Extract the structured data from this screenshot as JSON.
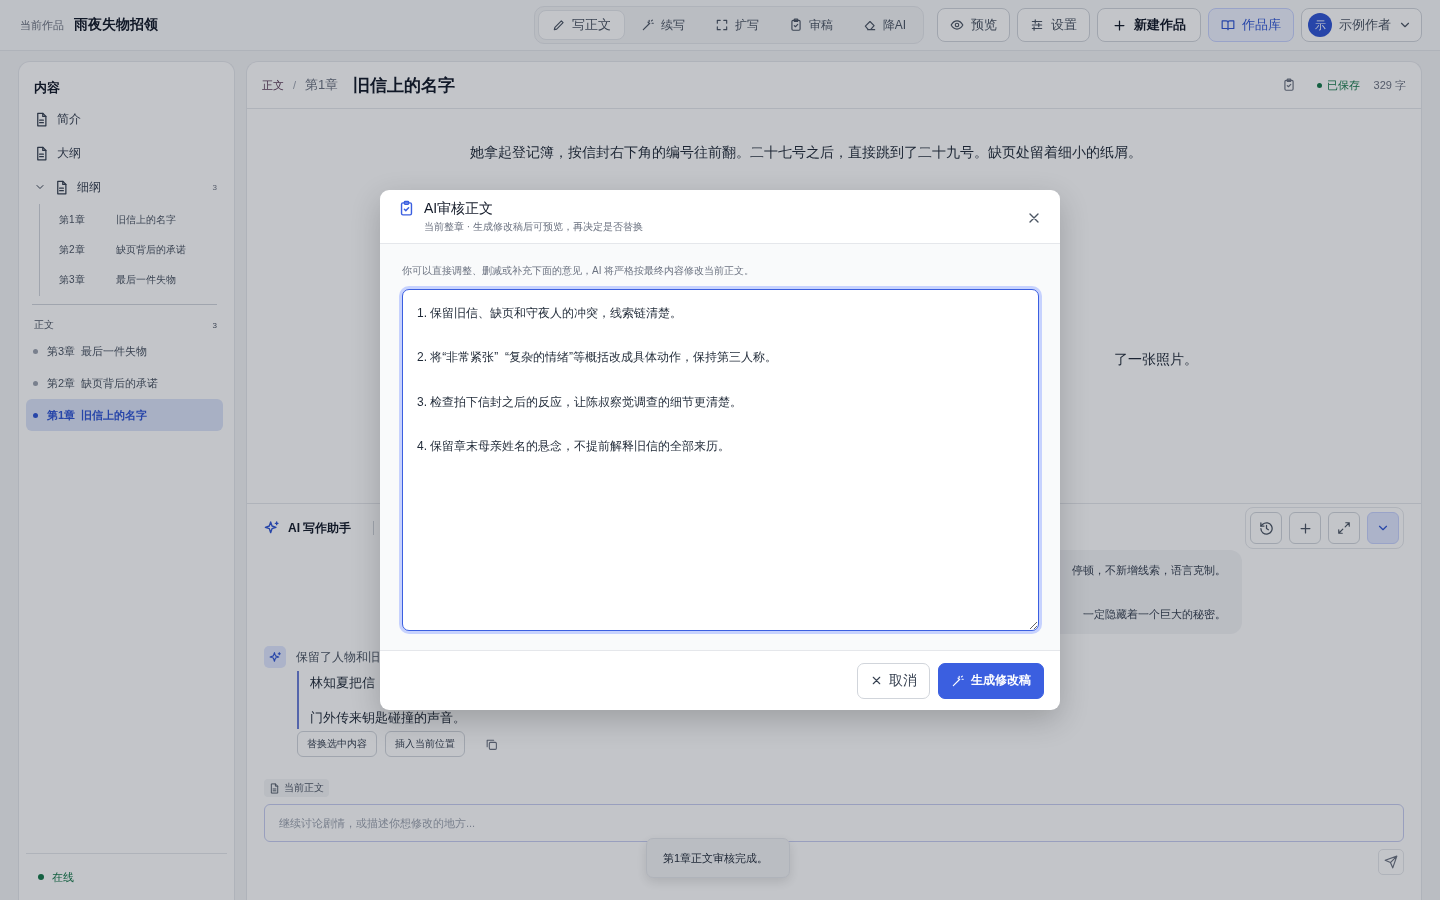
{
  "header": {
    "label": "当前作品",
    "work_title": "雨夜失物招领"
  },
  "toolbar": {
    "modes": [
      {
        "label": "写正文",
        "selected": true
      },
      {
        "label": "续写",
        "selected": false
      },
      {
        "label": "扩写",
        "selected": false
      },
      {
        "label": "审稿",
        "selected": false
      },
      {
        "label": "降AI",
        "selected": false
      }
    ],
    "buttons": [
      {
        "label": "预览",
        "kind": "plain"
      },
      {
        "label": "设置",
        "kind": "plain"
      },
      {
        "label": "新建作品",
        "kind": "strong"
      },
      {
        "label": "作品库",
        "kind": "accent"
      }
    ],
    "user": {
      "avatar": "示",
      "name": "示例作者"
    }
  },
  "sidebar": {
    "title": "内容",
    "items": [
      {
        "label": "简介"
      },
      {
        "label": "大纲"
      },
      {
        "label": "细纲",
        "count": "3",
        "expanded": true,
        "children": [
          {
            "chapter": "第1章",
            "title": "旧信上的名字"
          },
          {
            "chapter": "第2章",
            "title": "缺页背后的承诺"
          },
          {
            "chapter": "第3章",
            "title": "最后一件失物"
          }
        ]
      }
    ],
    "section": {
      "title": "正文",
      "count": "3",
      "chapters": [
        {
          "chapter": "第3章",
          "title": "最后一件失物",
          "selected": false
        },
        {
          "chapter": "第2章",
          "title": "缺页背后的承诺",
          "selected": false
        },
        {
          "chapter": "第1章",
          "title": "旧信上的名字",
          "selected": true
        }
      ]
    },
    "status": "在线"
  },
  "editor": {
    "breadcrumb": {
      "parts": [
        "正文",
        "第1章"
      ],
      "separator": "/"
    },
    "title": "旧信上的名字",
    "saved": "已保存",
    "word_count": "329 字",
    "paragraphs": [
      {
        "kind": "full",
        "text": "她拿起登记簿，按信封右下角的编号往前翻。二十七号之后，直接跳到了二十九号。缺页处留着细小的纸屑。"
      },
      {
        "kind": "tail",
        "text": "了一张照片。"
      }
    ]
  },
  "assistant": {
    "title": "AI 写作助手",
    "user_message": [
      "停顿，不新增线索，语言克制。",
      "一定隐藏着一个巨大的秘密。"
    ],
    "reply": {
      "summary": "保留了人物和旧",
      "quote": [
        "林知夏把信",
        "门外传来钥匙碰撞的声音。"
      ],
      "actions": [
        "替换选中内容",
        "插入当前位置"
      ]
    },
    "context_tag": "当前正文",
    "input": {
      "placeholder": "继续讨论剧情，或描述你想修改的地方..."
    }
  },
  "toast": "第1章正文审核完成。",
  "dialog": {
    "title": "AI审核正文",
    "subtitle": "当前整章 · 生成修改稿后可预览，再决定是否替换",
    "hint": "你可以直接调整、删减或补充下面的意见，AI 将严格按最终内容修改当前正文。",
    "value": "1. 保留旧信、缺页和守夜人的冲突，线索链清楚。\n\n2. 将“非常紧张”  “复杂的情绪”等概括改成具体动作，保持第三人称。\n\n3. 检查拍下信封之后的反应，让陈叔察觉调查的细节更清楚。\n\n4. 保留章末母亲姓名的悬念，不提前解释旧信的全部来历。",
    "buttons": [
      {
        "label": "取消",
        "kind": "secondary"
      },
      {
        "label": "生成修改稿",
        "kind": "primary"
      }
    ]
  }
}
